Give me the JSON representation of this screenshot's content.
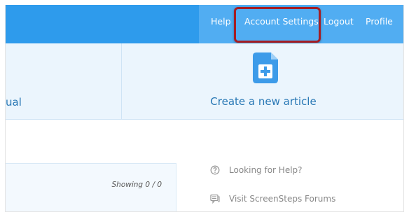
{
  "nav": {
    "help": "Help",
    "account_settings": "Account Settings",
    "logout": "Logout",
    "profile": "Profile"
  },
  "panel": {
    "left_label_partial": "ual",
    "create_article": "Create a new article",
    "create_icon": "document-plus-icon"
  },
  "list": {
    "showing": "Showing 0 / 0"
  },
  "help_links": [
    {
      "label": "Looking for Help?",
      "icon": "question-circle-icon"
    },
    {
      "label": "Visit ScreenSteps Forums",
      "icon": "forum-icon"
    }
  ],
  "colors": {
    "nav_bar": "#2e9bec",
    "nav_bar_right": "#51adf2",
    "highlight": "#a51d23",
    "link_blue": "#2978b5",
    "panel_bg": "#ebf5fd"
  }
}
